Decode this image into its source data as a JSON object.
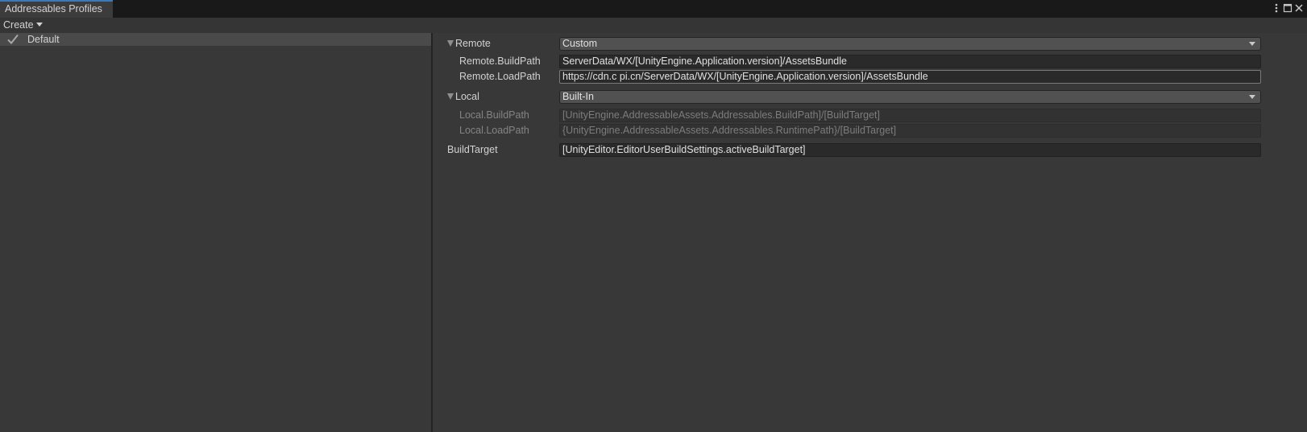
{
  "window": {
    "tab_title": "Addressables Profiles",
    "menu_icon": "kebab-menu-icon",
    "maximize_icon": "maximize-icon",
    "close_icon": "close-icon"
  },
  "toolbar": {
    "create_label": "Create"
  },
  "profiles": [
    {
      "name": "Default",
      "active": true,
      "icon": "checkmark-icon"
    }
  ],
  "variables": {
    "remote": {
      "label": "Remote",
      "expanded": true,
      "selected": "Custom",
      "build_path": {
        "label": "Remote.BuildPath",
        "value": "ServerData/WX/[UnityEngine.Application.version]/AssetsBundle"
      },
      "load_path": {
        "label": "Remote.LoadPath",
        "value": "https://cdn.c      pi.cn/ServerData/WX/[UnityEngine.Application.version]/AssetsBundle"
      }
    },
    "local": {
      "label": "Local",
      "expanded": true,
      "selected": "Built-In",
      "build_path": {
        "label": "Local.BuildPath",
        "value": "[UnityEngine.AddressableAssets.Addressables.BuildPath]/[BuildTarget]"
      },
      "load_path": {
        "label": "Local.LoadPath",
        "value": "{UnityEngine.AddressableAssets.Addressables.RuntimePath}/[BuildTarget]"
      }
    },
    "build_target": {
      "label": "BuildTarget",
      "value": "[UnityEditor.EditorUserBuildSettings.activeBuildTarget]"
    }
  },
  "colors": {
    "background": "#383838",
    "selected_row": "#4a4a4a",
    "tab_accent": "#3a79bb",
    "field_background": "#2a2a2a",
    "dropdown_background": "#515151"
  }
}
